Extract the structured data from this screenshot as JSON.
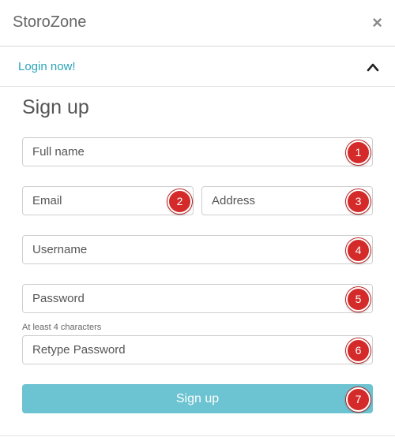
{
  "header": {
    "title": "StoroZone",
    "close_label": "×"
  },
  "login_bar": {
    "link_label": "Login now!",
    "toggle_icon": "chevron-up-icon"
  },
  "form": {
    "title": "Sign up",
    "fields": {
      "full_name": {
        "placeholder": "Full name",
        "badge": "1"
      },
      "email": {
        "placeholder": "Email",
        "badge": "2"
      },
      "address": {
        "placeholder": "Address",
        "badge": "3"
      },
      "username": {
        "placeholder": "Username",
        "badge": "4"
      },
      "password": {
        "placeholder": "Password",
        "badge": "5",
        "hint": "At least 4 characters"
      },
      "retype_password": {
        "placeholder": "Retype Password",
        "badge": "6"
      }
    },
    "submit": {
      "label": "Sign up",
      "badge": "7"
    }
  },
  "colors": {
    "accent": "#2aa3b8",
    "button": "#6cc3d1",
    "badge": "#d42a2a"
  }
}
